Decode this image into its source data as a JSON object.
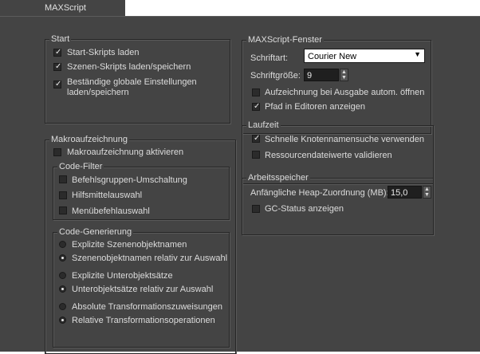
{
  "tab": {
    "label": "MAXScript"
  },
  "start": {
    "title": "Start",
    "items": [
      {
        "label": "Start-Skripts laden",
        "checked": true
      },
      {
        "label": "Szenen-Skripts laden/speichern",
        "checked": true
      },
      {
        "label": "Beständige globale Einstellungen",
        "label2": "laden/speichern",
        "checked": true
      }
    ]
  },
  "macro": {
    "title": "Makroaufzeichnung",
    "enable": {
      "label": "Makroaufzeichnung aktivieren",
      "checked": false
    },
    "filter": {
      "title": "Code-Filter",
      "items": [
        {
          "label": "Befehlsgruppen-Umschaltung",
          "checked": false
        },
        {
          "label": "Hilfsmittelauswahl",
          "checked": false
        },
        {
          "label": "Menübefehlauswahl",
          "checked": false
        }
      ]
    },
    "generation": {
      "title": "Code-Generierung",
      "items": [
        {
          "label": "Explizite Szenenobjektnamen",
          "selected": false
        },
        {
          "label": "Szenenobjektnamen relativ zur Auswahl",
          "selected": true
        },
        {
          "label": "Explizite Unterobjektsätze",
          "selected": false
        },
        {
          "label": "Unterobjektsätze relativ zur Auswahl",
          "selected": true
        },
        {
          "label": "Absolute Transformationszuweisungen",
          "selected": false
        },
        {
          "label": "Relative Transformationsoperationen",
          "selected": true
        }
      ]
    }
  },
  "editor": {
    "title": "MAXScript-Fenster",
    "font_label": "Schriftart:",
    "font_value": "Courier New",
    "size_label": "Schriftgröße:",
    "size_value": "9",
    "items": [
      {
        "label": "Aufzeichnung bei Ausgabe autom. öffnen",
        "checked": false
      },
      {
        "label": "Pfad in Editoren anzeigen",
        "checked": true
      }
    ]
  },
  "runtime": {
    "title": "Laufzeit",
    "items": [
      {
        "label": "Schnelle Knotennamensuche verwenden",
        "checked": true
      },
      {
        "label": "Ressourcendateiwerte validieren",
        "checked": false
      }
    ]
  },
  "memory": {
    "title": "Arbeitsspeicher",
    "heap_label": "Anfängliche Heap-Zuordnung (MB):",
    "heap_value": "15,0",
    "gc": {
      "label": "GC-Status anzeigen",
      "checked": false
    }
  },
  "colors": {
    "panel_bg": "#444444",
    "text": "#dcdcdc",
    "field_dark": "#1f1f1f"
  }
}
